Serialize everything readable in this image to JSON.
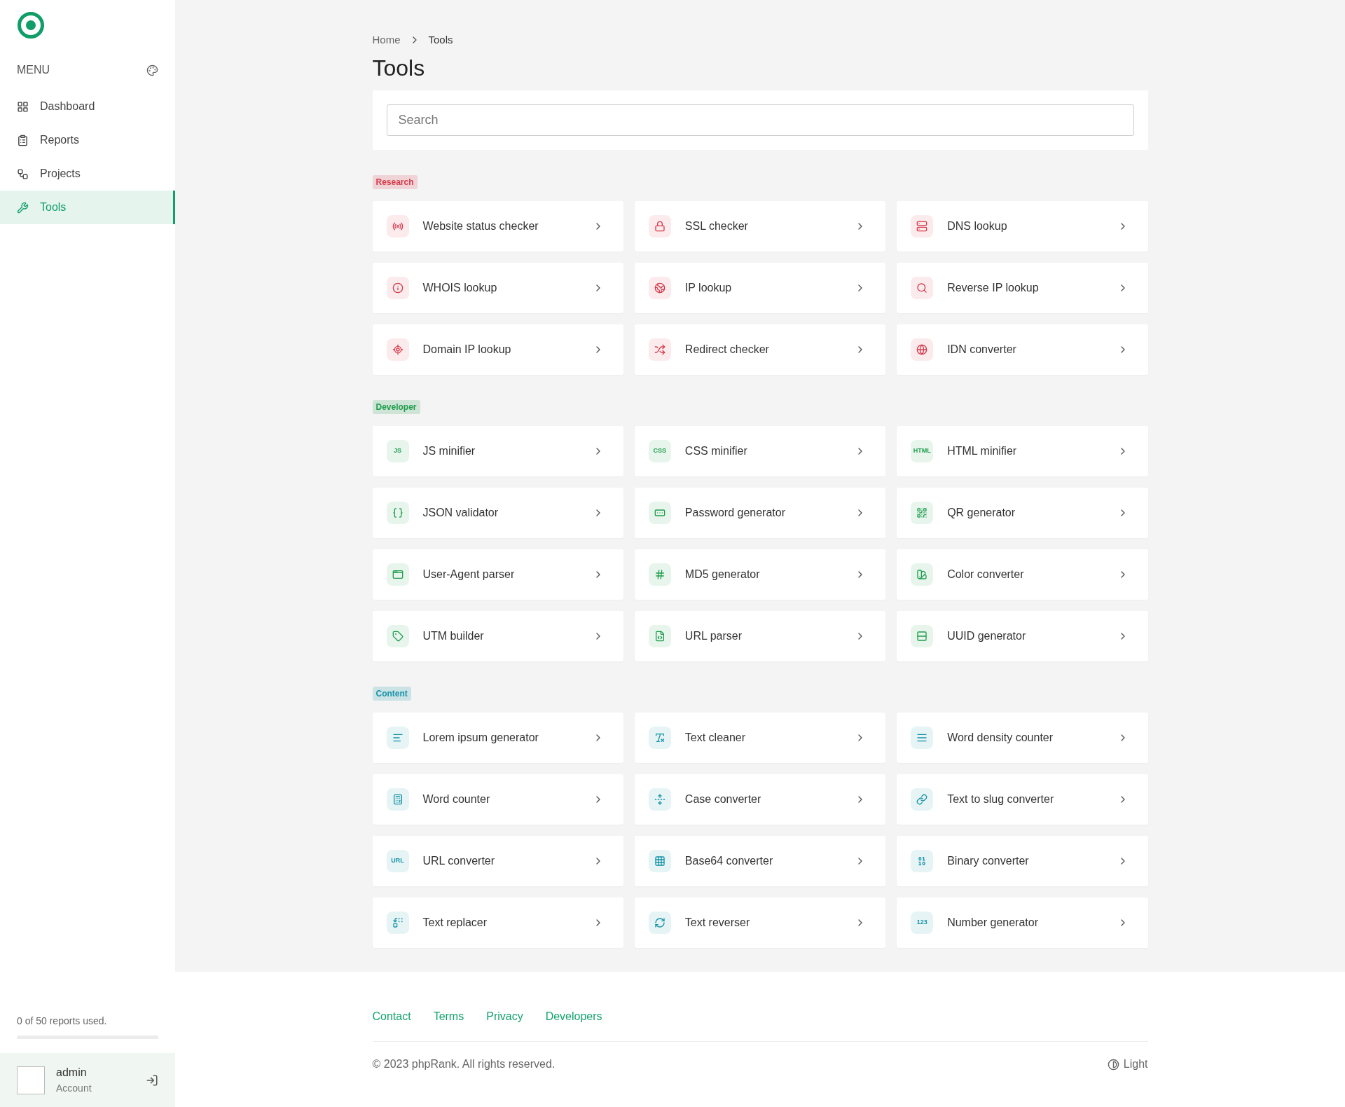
{
  "sidebar": {
    "menu_label": "MENU",
    "items": [
      {
        "label": "Dashboard",
        "selected": false
      },
      {
        "label": "Reports",
        "selected": false
      },
      {
        "label": "Projects",
        "selected": false
      },
      {
        "label": "Tools",
        "selected": true
      }
    ],
    "usage": {
      "text": "0 of 50 reports used.",
      "level": 0
    },
    "account": {
      "name": "admin",
      "subtitle": "Account"
    }
  },
  "breadcrumb": [
    "Home",
    "Tools"
  ],
  "title": "Tools",
  "search": {
    "placeholder": "Search"
  },
  "sections": [
    {
      "label": "Research",
      "color": "#d63b4b",
      "tools": [
        {
          "name": "Website status checker"
        },
        {
          "name": "SSL checker"
        },
        {
          "name": "DNS lookup"
        },
        {
          "name": "WHOIS lookup"
        },
        {
          "name": "IP lookup"
        },
        {
          "name": "Reverse IP lookup"
        },
        {
          "name": "Domain IP lookup"
        },
        {
          "name": "Redirect checker"
        },
        {
          "name": "IDN converter"
        }
      ]
    },
    {
      "label": "Developer",
      "color": "#1f9d4c",
      "tools": [
        {
          "name": "JS minifier",
          "icon_text": "JS"
        },
        {
          "name": "CSS minifier",
          "icon_text": "CSS"
        },
        {
          "name": "HTML minifier",
          "icon_text": "HTML"
        },
        {
          "name": "JSON validator"
        },
        {
          "name": "Password generator"
        },
        {
          "name": "QR generator"
        },
        {
          "name": "User-Agent parser"
        },
        {
          "name": "MD5 generator"
        },
        {
          "name": "Color converter"
        },
        {
          "name": "UTM builder"
        },
        {
          "name": "URL parser"
        },
        {
          "name": "UUID generator"
        }
      ]
    },
    {
      "label": "Content",
      "color": "#1793a8",
      "tools": [
        {
          "name": "Lorem ipsum generator"
        },
        {
          "name": "Text cleaner"
        },
        {
          "name": "Word density counter"
        },
        {
          "name": "Word counter"
        },
        {
          "name": "Case converter"
        },
        {
          "name": "Text to slug converter"
        },
        {
          "name": "URL converter",
          "icon_text": "URL"
        },
        {
          "name": "Base64 converter"
        },
        {
          "name": "Binary converter"
        },
        {
          "name": "Text replacer"
        },
        {
          "name": "Text reverser"
        },
        {
          "name": "Number generator",
          "icon_text": "123"
        }
      ]
    }
  ],
  "footer": {
    "links": [
      "Contact",
      "Terms",
      "Privacy",
      "Developers"
    ],
    "copyright": "© 2023 phpRank. All rights reserved.",
    "theme": "Light"
  }
}
